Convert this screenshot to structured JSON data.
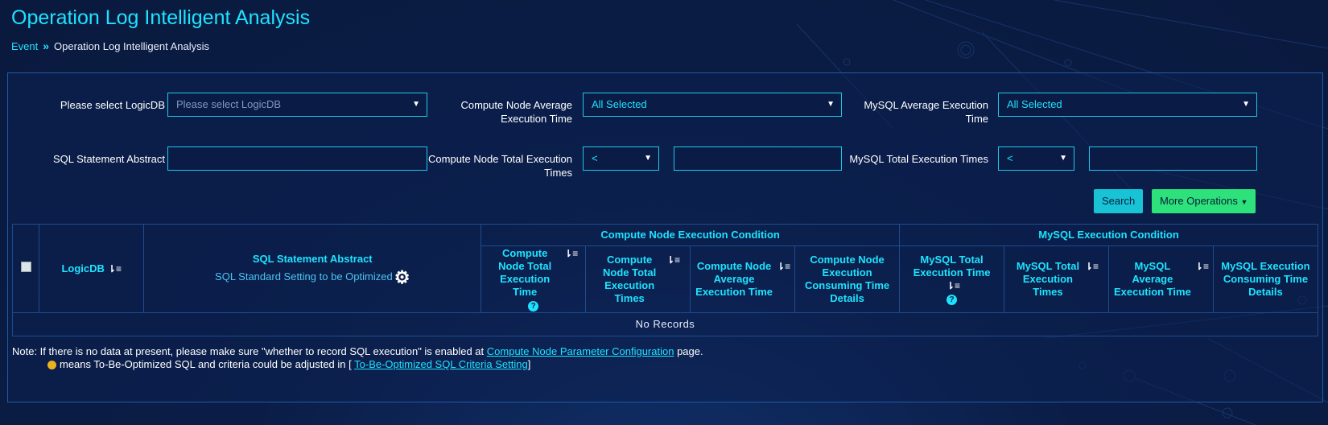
{
  "page": {
    "title": "Operation Log Intelligent Analysis",
    "breadcrumb": {
      "parent": "Event",
      "current": "Operation Log Intelligent Analysis"
    }
  },
  "filters": {
    "logicdb_label": "Please select LogicDB",
    "logicdb_placeholder": "Please select LogicDB",
    "cn_avg_label": "Compute Node Average Execution Time",
    "cn_avg_value": "All Selected",
    "mysql_avg_label": "MySQL Average Execution Time",
    "mysql_avg_value": "All Selected",
    "sql_label": "SQL Statement Abstract",
    "sql_value": "",
    "cn_total_label": "Compute Node Total Execution Times",
    "cn_total_op": "<",
    "cn_total_value": "",
    "mysql_total_label": "MySQL Total Execution Times",
    "mysql_total_op": "<",
    "mysql_total_value": ""
  },
  "actions": {
    "search": "Search",
    "more": "More Operations"
  },
  "table": {
    "col_logicdb": "LogicDB",
    "col_sql": "SQL Statement Abstract",
    "sql_setting": "SQL Standard Setting to be Optimized",
    "group_cn": "Compute Node Execution Condition",
    "group_mysql": "MySQL Execution Condition",
    "cn_total_time": "Compute Node Total Execution Time",
    "cn_total_times": "Compute Node Total Execution Times",
    "cn_avg_time": "Compute Node Average Execution Time",
    "cn_details": "Compute Node Execution Consuming Time Details",
    "my_total_time": "MySQL Total Execution Time",
    "my_total_times": "MySQL Total Execution Times",
    "my_avg_time": "MySQL Average Execution Time",
    "my_details": "MySQL Execution Consuming Time Details",
    "empty": "No Records",
    "help": "?"
  },
  "notes": {
    "line1_prefix": "Note: If there is no data at present, please make sure \"whether to record SQL execution\" is enabled at",
    "line1_link": "Compute Node Parameter Configuration",
    "line1_suffix": "page.",
    "line2_prefix": "means To-Be-Optimized SQL and criteria could be adjusted in [",
    "line2_link": "To-Be-Optimized SQL Criteria Setting",
    "line2_suffix": "]"
  },
  "colors": {
    "accent": "#1ee3ff",
    "search": "#18c3d6",
    "more": "#2de27a",
    "background": "#0b1d47"
  }
}
